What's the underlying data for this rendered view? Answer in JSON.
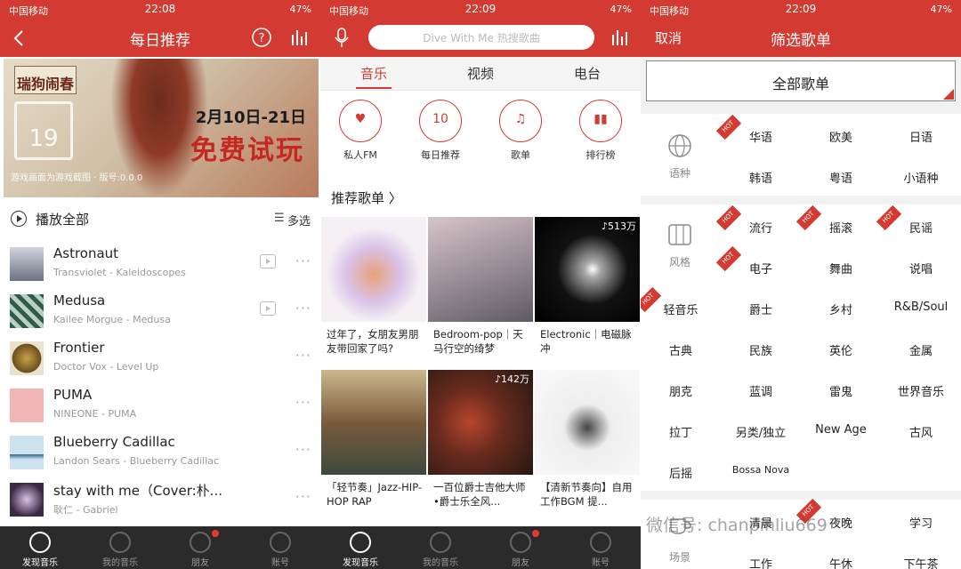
{
  "colors": {
    "accent": "#d33a31",
    "tabbar": "#2b2b2b"
  },
  "screen1": {
    "status": {
      "carrier": "中国移动",
      "time": "22:08",
      "battery": "47%"
    },
    "nav": {
      "back_icon": "chevron-left-icon",
      "title": "每日推荐",
      "help_icon": "question-circle-icon",
      "equalizer_icon": "equalizer-icon"
    },
    "banner": {
      "logo": "瑞狗闹春",
      "calendar_day": "19",
      "date": "2月10日-21日",
      "slogan": "免费试玩",
      "footer": "游戏画面为游戏截图  ·  版号:0.0.0"
    },
    "play_all": "播放全部",
    "multi_select": "多选",
    "songs": [
      {
        "title": "Astronaut",
        "sub": "Transviolet - Kaleidoscopes",
        "mv": true
      },
      {
        "title": "Medusa",
        "sub": "Kailee Morgue - Medusa",
        "mv": true
      },
      {
        "title": "Frontier",
        "sub": "Doctor Vox - Level Up",
        "mv": false
      },
      {
        "title": "PUMA",
        "sub": "NINEONE - PUMA",
        "mv": false
      },
      {
        "title": "Blueberry Cadillac",
        "sub": "Landon Sears - Blueberry Cadillac",
        "mv": false
      },
      {
        "title": "stay with me（Cover:朴...",
        "sub": "耿仁 - Gabriel",
        "mv": false
      }
    ],
    "tabs": [
      "发现音乐",
      "我的音乐",
      "朋友",
      "账号"
    ]
  },
  "screen2": {
    "status": {
      "carrier": "中国移动",
      "time": "22:09",
      "battery": "47%"
    },
    "search_placeholder": "Dive With Me 热搜歌曲",
    "subtabs": [
      "音乐",
      "视频",
      "电台"
    ],
    "entries": [
      {
        "label": "私人FM",
        "glyph": "♥"
      },
      {
        "label": "每日推荐",
        "glyph": "10"
      },
      {
        "label": "歌单",
        "glyph": "♫"
      },
      {
        "label": "排行榜",
        "glyph": "▮▮"
      }
    ],
    "section_title": "推荐歌单 〉",
    "playlists": [
      {
        "caption": "过年了，女朋友男朋友带回家了吗?",
        "count": ""
      },
      {
        "caption": "Bedroom-pop｜天马行空的绮梦",
        "count": ""
      },
      {
        "caption": "Electronic｜电磁脉冲",
        "count": "♪513万"
      },
      {
        "caption": "「轻节奏」Jazz-HIP-HOP RAP",
        "count": ""
      },
      {
        "caption": "一百位爵士吉他大师•爵士乐全风...",
        "count": "♪142万"
      },
      {
        "caption": "【清新节奏向】自用工作BGM 提...",
        "count": ""
      }
    ],
    "tabs": [
      "发现音乐",
      "我的音乐",
      "朋友",
      "账号"
    ]
  },
  "screen3": {
    "status": {
      "carrier": "中国移动",
      "time": "22:09",
      "battery": "47%"
    },
    "cancel": "取消",
    "title": "筛选歌单",
    "all": "全部歌单",
    "groups": [
      {
        "name": "语种",
        "tags": [
          "华语",
          "欧美",
          "日语",
          "韩语",
          "粤语",
          "小语种"
        ]
      },
      {
        "name": "风格",
        "tags": [
          "流行",
          "摇滚",
          "民谣",
          "电子",
          "舞曲",
          "说唱",
          "轻音乐",
          "爵士",
          "乡村",
          "R&B/Soul",
          "古典",
          "民族",
          "英伦",
          "金属",
          "朋克",
          "蓝调",
          "雷鬼",
          "世界音乐",
          "拉丁",
          "另类/独立",
          "New Age",
          "古风",
          "后摇",
          "Bossa Nova"
        ]
      },
      {
        "name": "场景",
        "tags": [
          "清晨",
          "夜晚",
          "学习",
          "工作",
          "午休",
          "下午茶"
        ]
      }
    ],
    "hot": "HOT",
    "watermark": "微信号: chanpinliu669"
  }
}
